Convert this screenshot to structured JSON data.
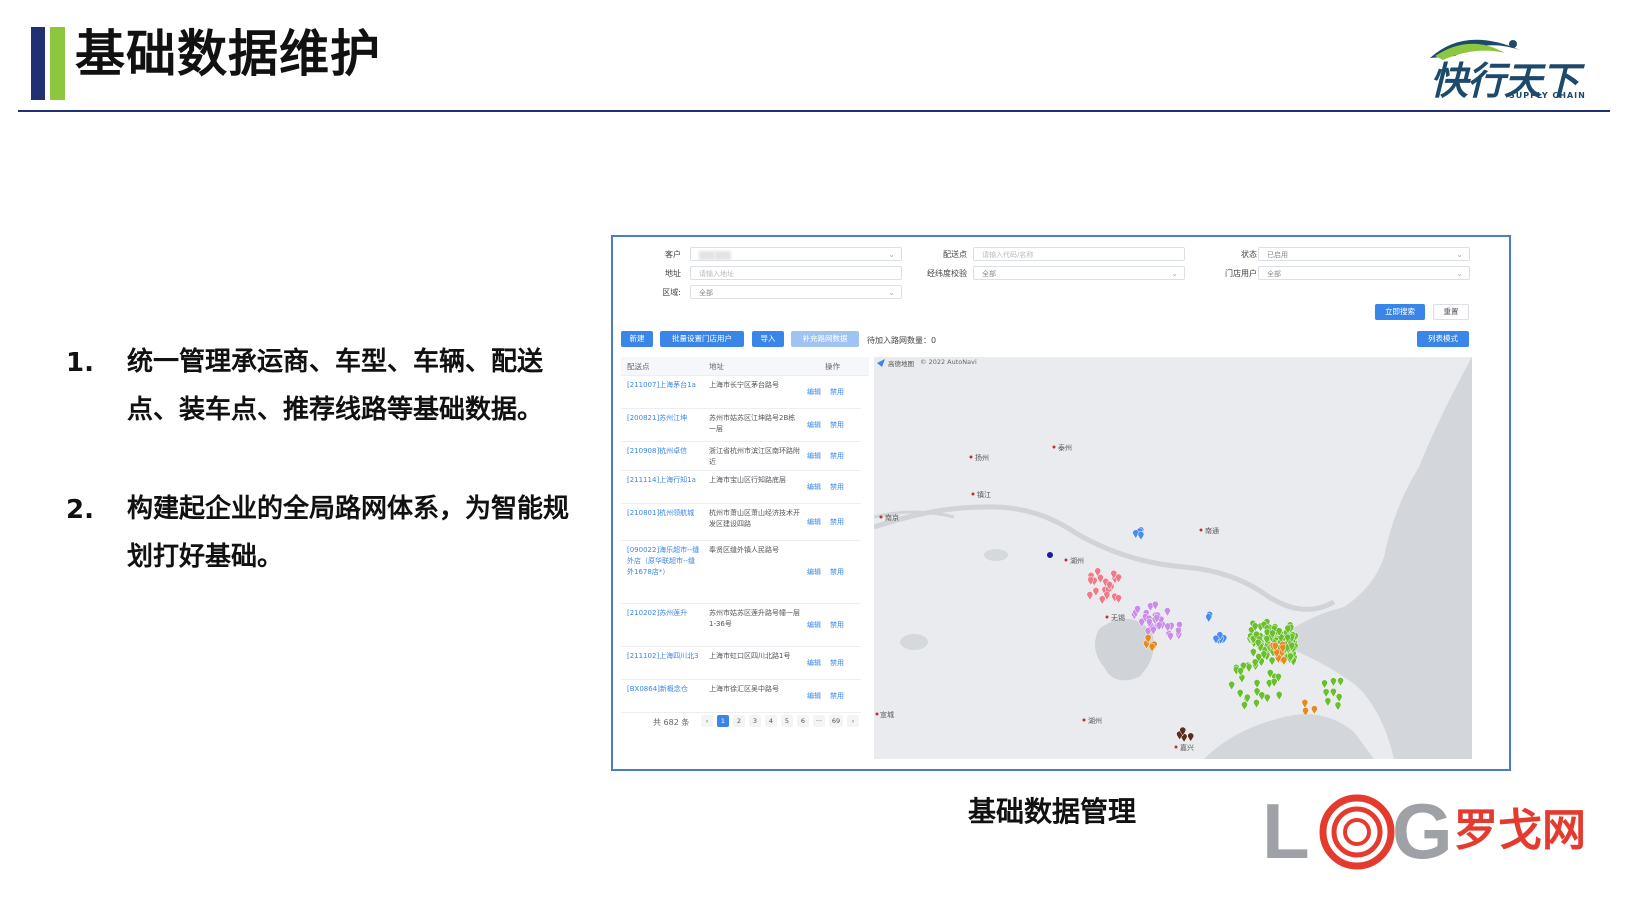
{
  "slide": {
    "title": "基础数据维护",
    "caption": "基础数据管理"
  },
  "brand": {
    "name": "快行天下",
    "sub": "SUPPLY CHAIN"
  },
  "watermark": {
    "text": "LOG罗戈网"
  },
  "bullets": [
    {
      "num": "1.",
      "text": "统一管理承运商、车型、车辆、配送点、装车点、推荐线路等基础数据。"
    },
    {
      "num": "2.",
      "text": "构建起企业的全局路网体系，为智能规划打好基础。"
    }
  ],
  "colors": {
    "navy": "#1f3173",
    "green": "#8dc63f",
    "accent": "#3a86e8"
  },
  "filters": {
    "customer": {
      "label": "客户",
      "value": ""
    },
    "address": {
      "label": "地址",
      "placeholder": "请输入地址"
    },
    "region": {
      "label": "区域:",
      "value": "全部"
    },
    "point": {
      "label": "配送点",
      "placeholder": "请输入代码/名称"
    },
    "geo_check": {
      "label": "经纬度校验",
      "value": "全部"
    },
    "status": {
      "label": "状态",
      "value": "已启用"
    },
    "store_user": {
      "label": "门店用户",
      "value": "全部"
    }
  },
  "actions": {
    "search": "立即搜索",
    "reset": "重置",
    "new": "新建",
    "batch": "批量设置门店用户",
    "import": "导入",
    "fill": "补充路网数据",
    "pending": "待加入路网数量：0",
    "list_mode": "列表模式"
  },
  "table": {
    "headers": [
      "配送点",
      "地址",
      "操作"
    ],
    "edit": "编辑",
    "disable": "禁用",
    "rows": [
      {
        "name": "[211007]上海茅台1a",
        "addr": "上海市长宁区茅台路号"
      },
      {
        "name": "[200821]苏州江坤",
        "addr": "苏州市姑苏区江坤路号2B栋一层"
      },
      {
        "name": "[210908]杭州卓信",
        "addr": "浙江省杭州市滨江区南环路附近"
      },
      {
        "name": "[211114]上海行知1a",
        "addr": "上海市宝山区行知路底层"
      },
      {
        "name": "[210801]杭州领航城",
        "addr": "杭州市萧山区萧山经济技术开发区建设四路"
      },
      {
        "name": "[090022]海乐超市--缝外店（原华联超市--缝外1678店*）",
        "addr": "奉贤区缝外镇人民路号"
      },
      {
        "name": "[210202]苏州莲升",
        "addr": "苏州市姑苏区莲升路号幢一层1-36号"
      },
      {
        "name": "[211102]上海四川北3",
        "addr": "上海市虹口区四川北路1号"
      },
      {
        "name": "[BX0864]新概念仓",
        "addr": "上海市徐汇区吴中路号"
      }
    ],
    "total": "共 682 条",
    "pages": [
      "1",
      "2",
      "3",
      "4",
      "5",
      "6",
      "···",
      "69"
    ]
  },
  "map": {
    "attribution": "高德地图",
    "copyright": "© 2022 AutoNavi",
    "cities": [
      "扬州",
      "泰州",
      "镇江",
      "南京",
      "南通",
      "湖州",
      "无锡",
      "宣城",
      "湖州",
      "嘉兴"
    ],
    "marker_colors": [
      "#6bbf2f",
      "#e9785b",
      "#f07a8a",
      "#c88de8",
      "#4a8df0",
      "#e58a20",
      "#5a2d1e"
    ]
  }
}
